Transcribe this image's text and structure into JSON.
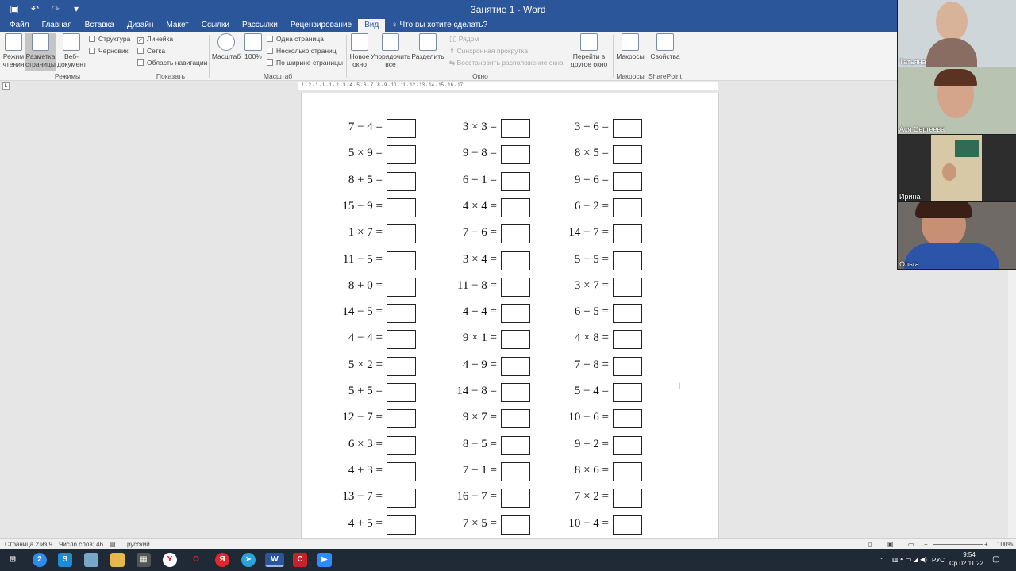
{
  "window": {
    "title": "Занятие 1 - Word"
  },
  "tabs": [
    {
      "label": "Файл"
    },
    {
      "label": "Главная"
    },
    {
      "label": "Вставка"
    },
    {
      "label": "Дизайн"
    },
    {
      "label": "Макет"
    },
    {
      "label": "Ссылки"
    },
    {
      "label": "Рассылки"
    },
    {
      "label": "Рецензирование"
    },
    {
      "label": "Вид",
      "active": true
    }
  ],
  "tellme": "Что вы хотите сделать?",
  "ribbon": {
    "modes": {
      "read_mode": "Режим чтения",
      "print_layout": "Разметка страницы",
      "web_layout": "Веб-документ",
      "outline": "Структура",
      "draft": "Черновик",
      "group_label": "Режимы"
    },
    "show": {
      "ruler": "Линейка",
      "gridlines": "Сетка",
      "nav_pane": "Область навигации",
      "group_label": "Показать",
      "ruler_checked": true
    },
    "zoom": {
      "zoom": "Масштаб",
      "hundred": "100%",
      "one_page": "Одна страница",
      "multiple_pages": "Несколько страниц",
      "page_width": "По ширине страницы",
      "group_label": "Масштаб"
    },
    "window": {
      "new_window": "Новое окно",
      "arrange_all": "Упорядочить все",
      "split": "Разделить",
      "side_by_side": "Рядом",
      "sync_scroll": "Синхронная прокрутка",
      "reset_pos": "Восстановить расположение окна",
      "switch": "Перейти в другое окно",
      "group_label": "Окно"
    },
    "macros": {
      "macros": "Макросы",
      "group_label": "Макросы"
    },
    "sharepoint": {
      "properties": "Свойства",
      "group_label": "SharePoint"
    }
  },
  "ruler_text": "1 · 2 · 1 · 1 · 1 · 2 · 3 · 4 · 5 · 6 · 7 · 8 · 9 · 10 · 11 · 12 · 13 · 14 · 15 · 16 · 17",
  "worksheet": {
    "col1": [
      "7 − 4 =",
      "5 × 9 =",
      "8 + 5 =",
      "15 − 9 =",
      "1 × 7 =",
      "11 − 5 =",
      "8 + 0 =",
      "14 − 5 =",
      "4 − 4 =",
      "5 × 2 =",
      "5 + 5 =",
      "12 − 7 =",
      "6 × 3 =",
      "4 + 3 =",
      "13 − 7 =",
      "4 + 5 ="
    ],
    "col2": [
      "3 × 3 =",
      "9 − 8 =",
      "6 + 1 =",
      "4 × 4 =",
      "7 + 6 =",
      "3 × 4 =",
      "11 − 8 =",
      "4 + 4 =",
      "9 × 1 =",
      "4 + 9 =",
      "14 − 8 =",
      "9 × 7 =",
      "8 − 5 =",
      "7 + 1 =",
      "16 − 7 =",
      "7 × 5 ="
    ],
    "col3": [
      "3 + 6 =",
      "8 × 5 =",
      "9 + 6 =",
      "6 − 2 =",
      "14 − 7 =",
      "5 + 5 =",
      "3 × 7 =",
      "6 + 5 =",
      "4 × 8 =",
      "7 + 8 =",
      "5 − 4 =",
      "10 − 6 =",
      "9 + 2 =",
      "8 × 6 =",
      "7 × 2 =",
      "10 − 4 ="
    ]
  },
  "participants": [
    {
      "name": "Татьяна"
    },
    {
      "name": "Ася Сергеева"
    },
    {
      "name": "Ирина"
    },
    {
      "name": "Ольга"
    }
  ],
  "status": {
    "page": "Страница 2 из 9",
    "words": "Число слов: 46",
    "language": "русский",
    "zoom": "100%"
  },
  "tray": {
    "lang": "РУС",
    "time": "9:54",
    "date": "Ср 02.11.22"
  }
}
